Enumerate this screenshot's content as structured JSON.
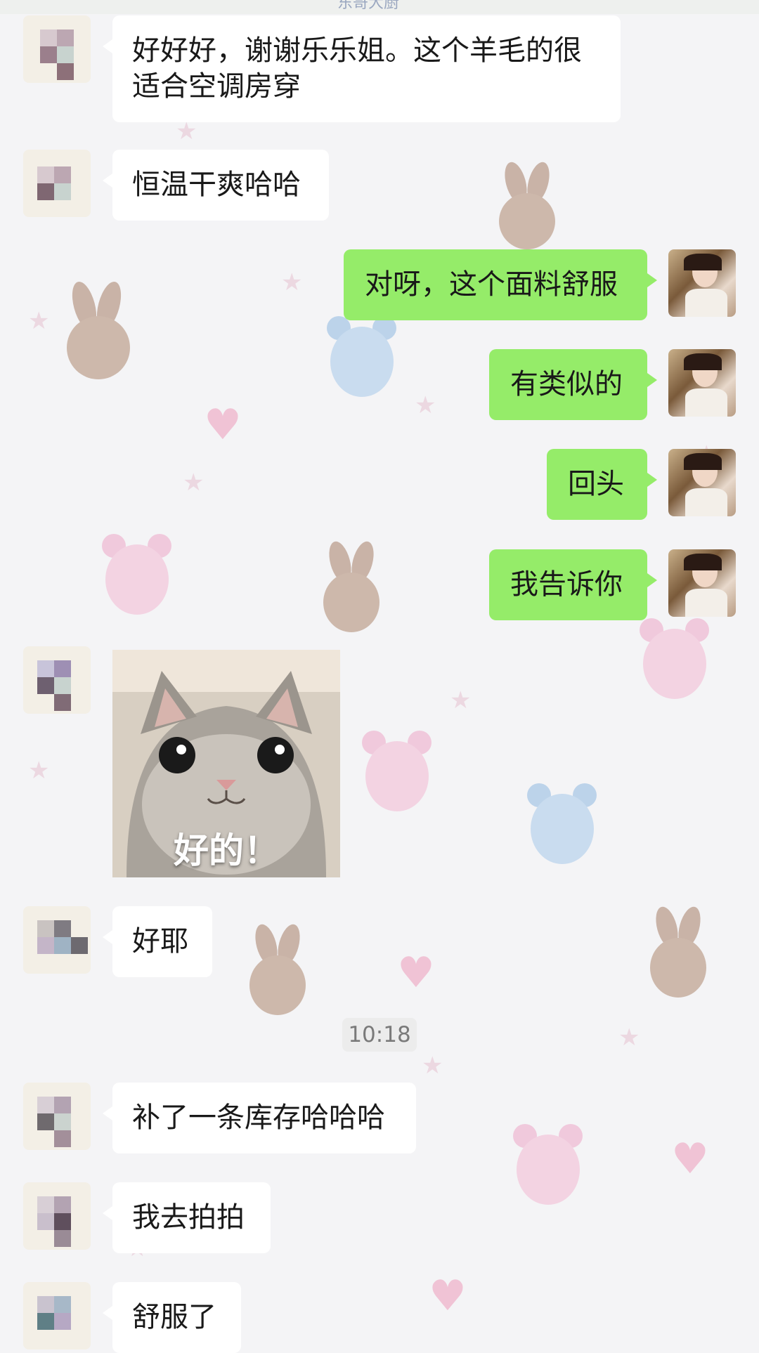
{
  "header": {
    "title_partial": "东哥大厨"
  },
  "messages": [
    {
      "id": "m1",
      "side": "incoming",
      "type": "text",
      "text": "好好好，谢谢乐乐姐。这个羊毛的很适合空调房穿"
    },
    {
      "id": "m2",
      "side": "incoming",
      "type": "text",
      "text": "恒温干爽哈哈"
    },
    {
      "id": "m3",
      "side": "outgoing",
      "type": "text",
      "text": "对呀，这个面料舒服"
    },
    {
      "id": "m4",
      "side": "outgoing",
      "type": "text",
      "text": "有类似的"
    },
    {
      "id": "m5",
      "side": "outgoing",
      "type": "text",
      "text": "回头"
    },
    {
      "id": "m6",
      "side": "outgoing",
      "type": "text",
      "text": "我告诉你"
    },
    {
      "id": "m7",
      "side": "incoming",
      "type": "sticker",
      "caption": "好的！",
      "icon": "cat-sticker"
    },
    {
      "id": "m8",
      "side": "incoming",
      "type": "text",
      "text": "好耶"
    },
    {
      "id": "m9",
      "side": "incoming",
      "type": "text",
      "text": "补了一条库存哈哈哈"
    },
    {
      "id": "m10",
      "side": "incoming",
      "type": "text",
      "text": "我去拍拍"
    },
    {
      "id": "m11",
      "side": "incoming",
      "type": "text",
      "text": "舒服了"
    }
  ],
  "timestamp": "10:18",
  "colors": {
    "outgoing_bubble": "#95ec69",
    "incoming_bubble": "#ffffff",
    "wallpaper": "#f4f4f6",
    "time_chip": "#ececec"
  }
}
